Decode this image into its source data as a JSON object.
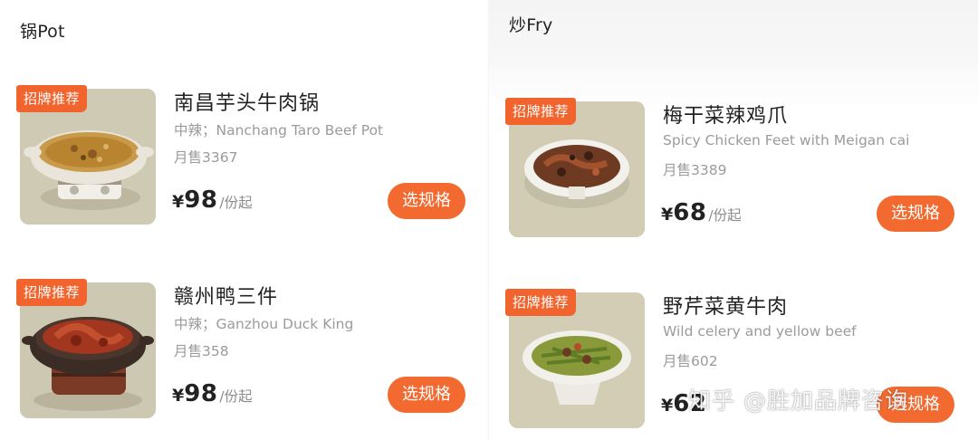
{
  "left_panel": {
    "category_title": "锅Pot",
    "dishes": [
      {
        "badge": "招牌推荐",
        "name": "南昌芋头牛肉锅",
        "desc": "中辣；Nanchang Taro Beef Pot",
        "sales": "月售3367",
        "price_symbol": "¥",
        "price": "98",
        "price_unit": "/份起",
        "button": "选规格",
        "image_icon": "beef-taro-pot-image"
      },
      {
        "badge": "招牌推荐",
        "name": "赣州鸭三件",
        "desc": "中辣；Ganzhou Duck King",
        "sales": "月售358",
        "price_symbol": "¥",
        "price": "98",
        "price_unit": "/份起",
        "button": "选规格",
        "image_icon": "duck-claypot-image"
      }
    ]
  },
  "right_panel": {
    "category_title": "炒Fry",
    "dishes": [
      {
        "badge": "招牌推荐",
        "name": "梅干菜辣鸡爪",
        "desc": "Spicy Chicken Feet with Meigan cai",
        "sales": "月售3389",
        "price_symbol": "¥",
        "price": "68",
        "price_unit": "/份起",
        "button": "选规格",
        "image_icon": "chicken-feet-plate-image"
      },
      {
        "badge": "招牌推荐",
        "name": "野芹菜黄牛肉",
        "desc": "Wild celery and yellow beef",
        "sales": "月售602",
        "price_symbol": "¥",
        "price": "62",
        "price_unit": "",
        "button": "选规格",
        "image_icon": "celery-beef-bowl-image"
      }
    ]
  },
  "watermark": "知乎 @胜加品牌咨询",
  "colors": {
    "accent": "#f26a30",
    "badge": "#f2642d",
    "text_primary": "#222222",
    "text_secondary": "#9b9b9b",
    "photo_background": "#cdc8b2"
  }
}
